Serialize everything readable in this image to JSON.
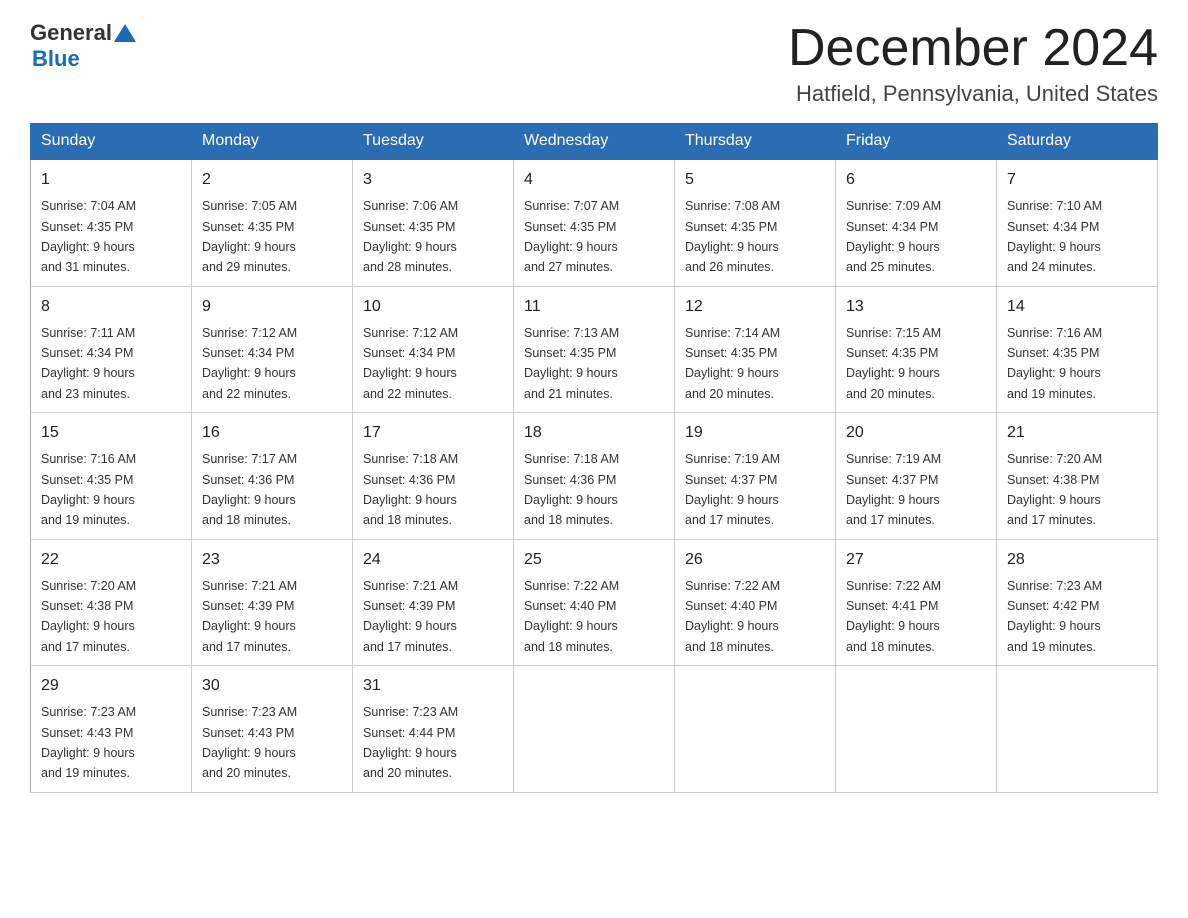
{
  "header": {
    "logo": {
      "general": "General",
      "blue": "Blue"
    },
    "title": "December 2024",
    "location": "Hatfield, Pennsylvania, United States"
  },
  "weekdays": [
    "Sunday",
    "Monday",
    "Tuesday",
    "Wednesday",
    "Thursday",
    "Friday",
    "Saturday"
  ],
  "weeks": [
    [
      {
        "day": "1",
        "sunrise": "7:04 AM",
        "sunset": "4:35 PM",
        "daylight": "9 hours and 31 minutes."
      },
      {
        "day": "2",
        "sunrise": "7:05 AM",
        "sunset": "4:35 PM",
        "daylight": "9 hours and 29 minutes."
      },
      {
        "day": "3",
        "sunrise": "7:06 AM",
        "sunset": "4:35 PM",
        "daylight": "9 hours and 28 minutes."
      },
      {
        "day": "4",
        "sunrise": "7:07 AM",
        "sunset": "4:35 PM",
        "daylight": "9 hours and 27 minutes."
      },
      {
        "day": "5",
        "sunrise": "7:08 AM",
        "sunset": "4:35 PM",
        "daylight": "9 hours and 26 minutes."
      },
      {
        "day": "6",
        "sunrise": "7:09 AM",
        "sunset": "4:34 PM",
        "daylight": "9 hours and 25 minutes."
      },
      {
        "day": "7",
        "sunrise": "7:10 AM",
        "sunset": "4:34 PM",
        "daylight": "9 hours and 24 minutes."
      }
    ],
    [
      {
        "day": "8",
        "sunrise": "7:11 AM",
        "sunset": "4:34 PM",
        "daylight": "9 hours and 23 minutes."
      },
      {
        "day": "9",
        "sunrise": "7:12 AM",
        "sunset": "4:34 PM",
        "daylight": "9 hours and 22 minutes."
      },
      {
        "day": "10",
        "sunrise": "7:12 AM",
        "sunset": "4:34 PM",
        "daylight": "9 hours and 22 minutes."
      },
      {
        "day": "11",
        "sunrise": "7:13 AM",
        "sunset": "4:35 PM",
        "daylight": "9 hours and 21 minutes."
      },
      {
        "day": "12",
        "sunrise": "7:14 AM",
        "sunset": "4:35 PM",
        "daylight": "9 hours and 20 minutes."
      },
      {
        "day": "13",
        "sunrise": "7:15 AM",
        "sunset": "4:35 PM",
        "daylight": "9 hours and 20 minutes."
      },
      {
        "day": "14",
        "sunrise": "7:16 AM",
        "sunset": "4:35 PM",
        "daylight": "9 hours and 19 minutes."
      }
    ],
    [
      {
        "day": "15",
        "sunrise": "7:16 AM",
        "sunset": "4:35 PM",
        "daylight": "9 hours and 19 minutes."
      },
      {
        "day": "16",
        "sunrise": "7:17 AM",
        "sunset": "4:36 PM",
        "daylight": "9 hours and 18 minutes."
      },
      {
        "day": "17",
        "sunrise": "7:18 AM",
        "sunset": "4:36 PM",
        "daylight": "9 hours and 18 minutes."
      },
      {
        "day": "18",
        "sunrise": "7:18 AM",
        "sunset": "4:36 PM",
        "daylight": "9 hours and 18 minutes."
      },
      {
        "day": "19",
        "sunrise": "7:19 AM",
        "sunset": "4:37 PM",
        "daylight": "9 hours and 17 minutes."
      },
      {
        "day": "20",
        "sunrise": "7:19 AM",
        "sunset": "4:37 PM",
        "daylight": "9 hours and 17 minutes."
      },
      {
        "day": "21",
        "sunrise": "7:20 AM",
        "sunset": "4:38 PM",
        "daylight": "9 hours and 17 minutes."
      }
    ],
    [
      {
        "day": "22",
        "sunrise": "7:20 AM",
        "sunset": "4:38 PM",
        "daylight": "9 hours and 17 minutes."
      },
      {
        "day": "23",
        "sunrise": "7:21 AM",
        "sunset": "4:39 PM",
        "daylight": "9 hours and 17 minutes."
      },
      {
        "day": "24",
        "sunrise": "7:21 AM",
        "sunset": "4:39 PM",
        "daylight": "9 hours and 17 minutes."
      },
      {
        "day": "25",
        "sunrise": "7:22 AM",
        "sunset": "4:40 PM",
        "daylight": "9 hours and 18 minutes."
      },
      {
        "day": "26",
        "sunrise": "7:22 AM",
        "sunset": "4:40 PM",
        "daylight": "9 hours and 18 minutes."
      },
      {
        "day": "27",
        "sunrise": "7:22 AM",
        "sunset": "4:41 PM",
        "daylight": "9 hours and 18 minutes."
      },
      {
        "day": "28",
        "sunrise": "7:23 AM",
        "sunset": "4:42 PM",
        "daylight": "9 hours and 19 minutes."
      }
    ],
    [
      {
        "day": "29",
        "sunrise": "7:23 AM",
        "sunset": "4:43 PM",
        "daylight": "9 hours and 19 minutes."
      },
      {
        "day": "30",
        "sunrise": "7:23 AM",
        "sunset": "4:43 PM",
        "daylight": "9 hours and 20 minutes."
      },
      {
        "day": "31",
        "sunrise": "7:23 AM",
        "sunset": "4:44 PM",
        "daylight": "9 hours and 20 minutes."
      },
      null,
      null,
      null,
      null
    ]
  ],
  "labels": {
    "sunrise": "Sunrise:",
    "sunset": "Sunset:",
    "daylight": "Daylight:"
  }
}
